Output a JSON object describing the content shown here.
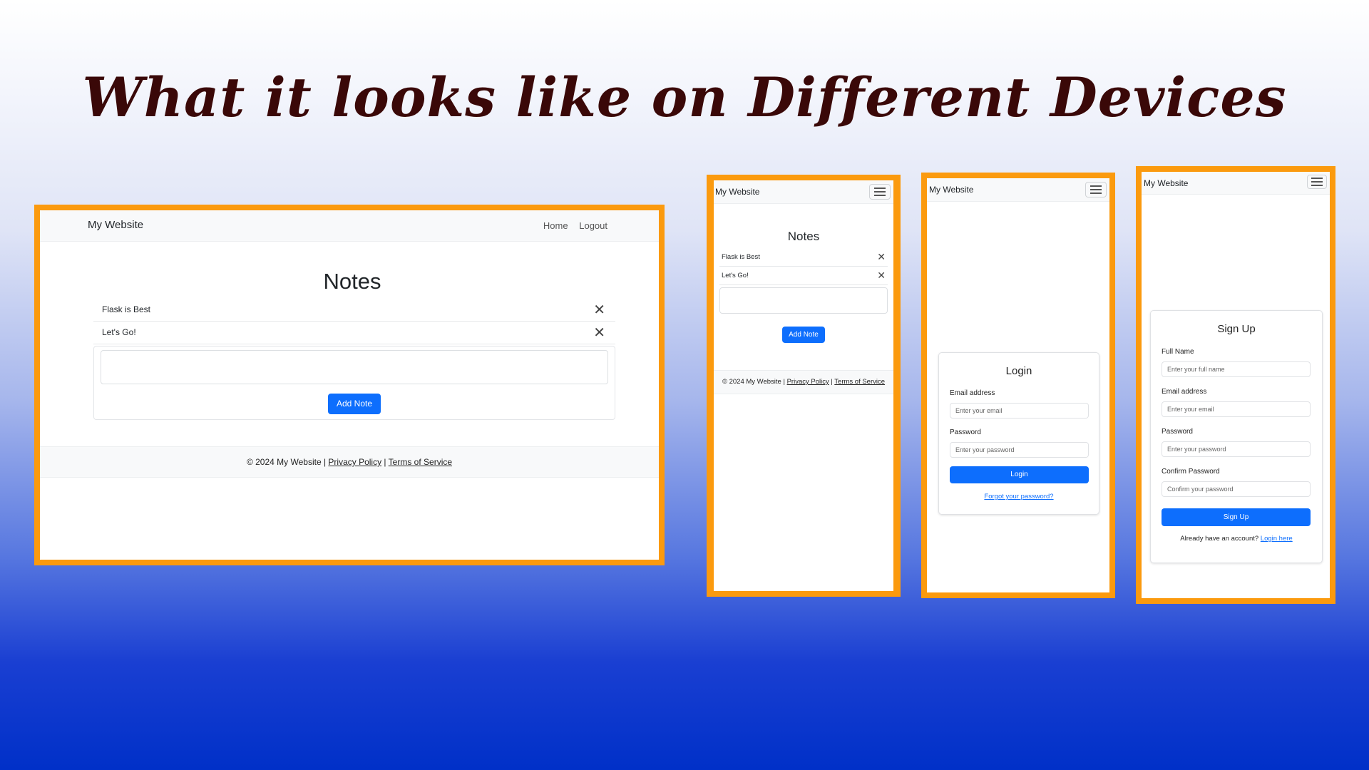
{
  "slide_title": "What it looks like on Different Devices",
  "brand": "My Website",
  "desktop": {
    "nav_home": "Home",
    "nav_logout": "Logout",
    "notes_heading": "Notes",
    "notes": [
      "Flask is Best",
      "Let's Go!"
    ],
    "add_note_label": "Add Note",
    "footer_prefix": "© 2024 My Website | ",
    "privacy_label": "Privacy Policy",
    "separator": " | ",
    "terms_label": "Terms of Service"
  },
  "mobile_notes": {
    "notes_heading": "Notes",
    "notes": [
      "Flask is Best",
      "Let's Go!"
    ],
    "add_note_label": "Add Note",
    "footer_prefix": "© 2024 My Website | ",
    "privacy_label": "Privacy Policy",
    "separator": " | ",
    "terms_label": "Terms of Service"
  },
  "mobile_login": {
    "heading": "Login",
    "email_label": "Email address",
    "email_placeholder": "Enter your email",
    "password_label": "Password",
    "password_placeholder": "Enter your password",
    "button_label": "Login",
    "forgot_label": "Forgot your password?"
  },
  "mobile_signup": {
    "heading": "Sign Up",
    "fullname_label": "Full Name",
    "fullname_placeholder": "Enter your full name",
    "email_label": "Email address",
    "email_placeholder": "Enter your email",
    "password_label": "Password",
    "password_placeholder": "Enter your password",
    "confirm_label": "Confirm Password",
    "confirm_placeholder": "Confirm your password",
    "button_label": "Sign Up",
    "account_text": "Already have an account?",
    "login_link": "Login here"
  },
  "icons": {
    "close": "close-icon",
    "menu": "hamburger-menu-icon"
  },
  "colors": {
    "frame": "#fb9a0e",
    "primary": "#0d6efd",
    "title": "#3a0808"
  }
}
